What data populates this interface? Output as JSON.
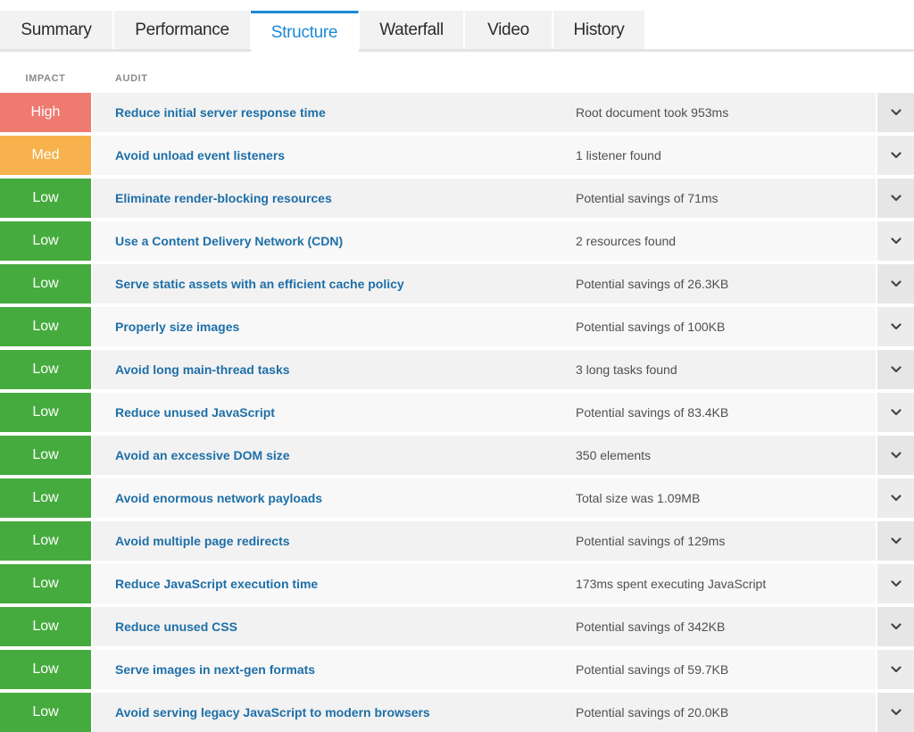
{
  "tabs": [
    {
      "label": "Summary",
      "active": false
    },
    {
      "label": "Performance",
      "active": false
    },
    {
      "label": "Structure",
      "active": true
    },
    {
      "label": "Waterfall",
      "active": false
    },
    {
      "label": "Video",
      "active": false
    },
    {
      "label": "History",
      "active": false
    }
  ],
  "header": {
    "impact": "IMPACT",
    "audit": "AUDIT"
  },
  "colors": {
    "High": "#ee7a70",
    "Med": "#f7b24d",
    "Low": "#46ab3e",
    "row_shade_a": "#f2f2f2",
    "row_shade_b": "#f8f8f8",
    "accent": "#1e88d6",
    "link": "#1e6fa8"
  },
  "toggle_icon": "chevron-down-icon",
  "rows": [
    {
      "impact": "High",
      "title": "Reduce initial server response time",
      "detail": "Root document took 953ms"
    },
    {
      "impact": "Med",
      "title": "Avoid unload event listeners",
      "detail": "1 listener found"
    },
    {
      "impact": "Low",
      "title": "Eliminate render-blocking resources",
      "detail": "Potential savings of 71ms"
    },
    {
      "impact": "Low",
      "title": "Use a Content Delivery Network (CDN)",
      "detail": "2 resources found"
    },
    {
      "impact": "Low",
      "title": "Serve static assets with an efficient cache policy",
      "detail": "Potential savings of 26.3KB"
    },
    {
      "impact": "Low",
      "title": "Properly size images",
      "detail": "Potential savings of 100KB"
    },
    {
      "impact": "Low",
      "title": "Avoid long main-thread tasks",
      "detail": "3 long tasks found"
    },
    {
      "impact": "Low",
      "title": "Reduce unused JavaScript",
      "detail": "Potential savings of 83.4KB"
    },
    {
      "impact": "Low",
      "title": "Avoid an excessive DOM size",
      "detail": "350 elements"
    },
    {
      "impact": "Low",
      "title": "Avoid enormous network payloads",
      "detail": "Total size was 1.09MB"
    },
    {
      "impact": "Low",
      "title": "Avoid multiple page redirects",
      "detail": "Potential savings of 129ms"
    },
    {
      "impact": "Low",
      "title": "Reduce JavaScript execution time",
      "detail": "173ms spent executing JavaScript"
    },
    {
      "impact": "Low",
      "title": "Reduce unused CSS",
      "detail": "Potential savings of 342KB"
    },
    {
      "impact": "Low",
      "title": "Serve images in next-gen formats",
      "detail": "Potential savings of 59.7KB"
    },
    {
      "impact": "Low",
      "title": "Avoid serving legacy JavaScript to modern browsers",
      "detail": "Potential savings of 20.0KB"
    }
  ]
}
